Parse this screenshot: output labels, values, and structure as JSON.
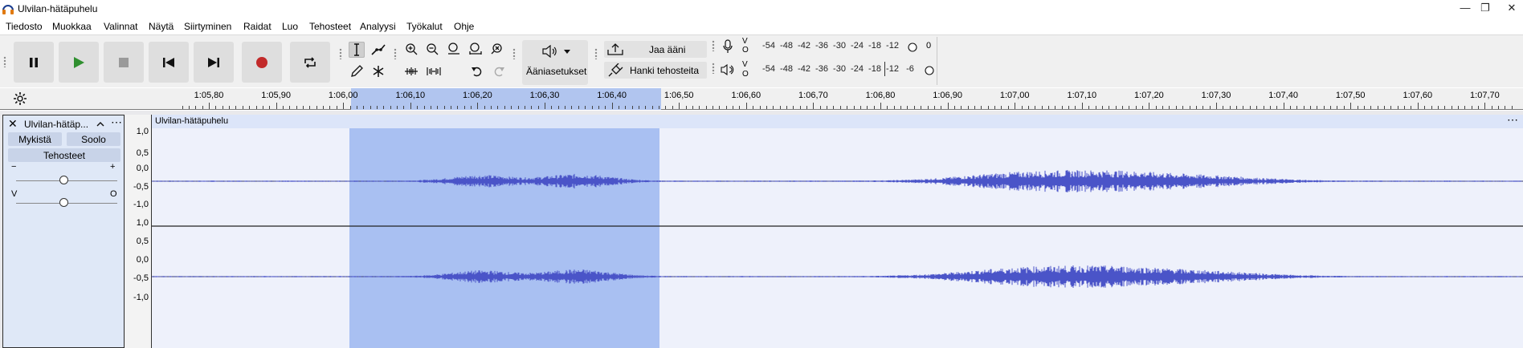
{
  "window": {
    "title": "Ulvilan-hätäpuhelu",
    "minimize": "—",
    "maximize": "❐",
    "close": "✕"
  },
  "menu": [
    "Tiedosto",
    "Muokkaa",
    "Valinnat",
    "Näytä",
    "Siirtyminen",
    "Raidat",
    "Luo",
    "Tehosteet",
    "Analyysi",
    "Työkalut",
    "Ohje"
  ],
  "toolbar": {
    "audio_setup_label": "Ääniasetukset",
    "share_label": "Jaa ääni",
    "get_effects_label": "Hanki tehosteita",
    "meter_scale": [
      "-54",
      "-48",
      "-42",
      "-36",
      "-30",
      "-24",
      "-18",
      "-12",
      "-6"
    ],
    "record_meter_end": "0",
    "lr_top": "V",
    "lr_bottom": "O",
    "record_color": "#c22a2a",
    "play_color": "#2f8f2f"
  },
  "ruler": {
    "ticks": [
      "1:05,80",
      "1:05,90",
      "1:06,00",
      "1:06,10",
      "1:06,20",
      "1:06,30",
      "1:06,40",
      "1:06,50",
      "1:06,60",
      "1:06,70",
      "1:06,80",
      "1:06,90",
      "1:07,00",
      "1:07,10",
      "1:07,20",
      "1:07,30",
      "1:07,40",
      "1:07,50",
      "1:07,60",
      "1:07,70"
    ]
  },
  "track": {
    "name": "Ulvilan-hätäp...",
    "mute_label": "Mykistä",
    "solo_label": "Soolo",
    "effects_label": "Tehosteet",
    "gain_minus": "−",
    "gain_plus": "+",
    "pan_left": "V",
    "pan_right": "O",
    "clip_name": "Ulvilan-hätäpuhelu",
    "scale_labels": [
      "1,0",
      "0,5",
      "0,0",
      "-0,5",
      "-1,0"
    ],
    "selection_color": "#a9c0f2",
    "wave_color": "#4a54c8"
  }
}
